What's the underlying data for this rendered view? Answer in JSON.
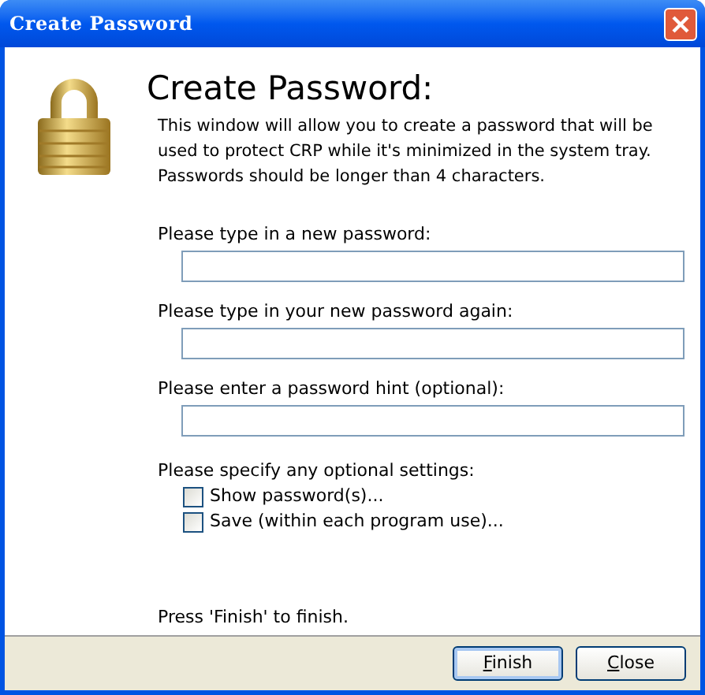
{
  "window": {
    "title": "Create Password"
  },
  "heading": "Create Password:",
  "description": "This window will allow you to create a password that will be used to protect CRP while it's minimized in the system tray. Passwords should be longer than 4 characters.",
  "fields": [
    {
      "label": "Please type in a new password:"
    },
    {
      "label": "Please type in your new password again:"
    },
    {
      "label": "Please enter a password hint (optional):"
    }
  ],
  "settings": {
    "label": "Please specify any optional settings:",
    "options": [
      {
        "label": "Show password(s)...",
        "checked": false
      },
      {
        "label": "Save (within each program use)...",
        "checked": false
      }
    ]
  },
  "footer_note": "Press 'Finish' to finish.",
  "buttons": [
    {
      "label": "Finish",
      "default": true
    },
    {
      "label": "Close",
      "default": false
    }
  ]
}
